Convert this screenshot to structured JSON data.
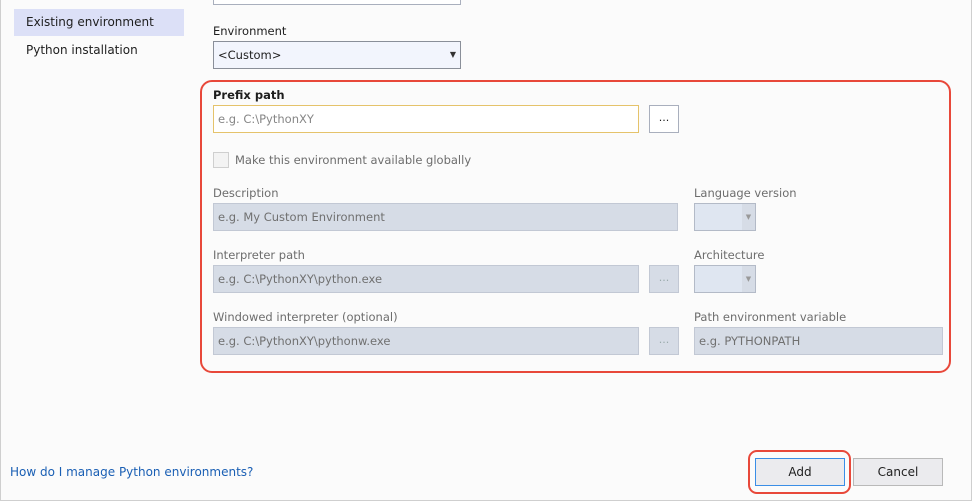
{
  "sidebar": {
    "items": [
      {
        "label": "Existing environment",
        "selected": true
      },
      {
        "label": "Python installation",
        "selected": false
      }
    ]
  },
  "environment": {
    "label": "Environment",
    "value": "<Custom>"
  },
  "prefix": {
    "label": "Prefix path",
    "placeholder": "e.g. C:\\PythonXY",
    "browse": "..."
  },
  "global_checkbox": {
    "label": "Make this environment available globally",
    "checked": false
  },
  "description": {
    "label": "Description",
    "placeholder": "e.g. My Custom Environment"
  },
  "language_version": {
    "label": "Language version"
  },
  "interpreter": {
    "label": "Interpreter path",
    "placeholder": "e.g. C:\\PythonXY\\python.exe",
    "browse": "..."
  },
  "architecture": {
    "label": "Architecture"
  },
  "windowed": {
    "label": "Windowed interpreter (optional)",
    "placeholder": "e.g. C:\\PythonXY\\pythonw.exe",
    "browse": "..."
  },
  "path_var": {
    "label": "Path environment variable",
    "placeholder": "e.g. PYTHONPATH"
  },
  "footer": {
    "help_link": "How do I manage Python environments?",
    "add": "Add",
    "cancel": "Cancel"
  }
}
